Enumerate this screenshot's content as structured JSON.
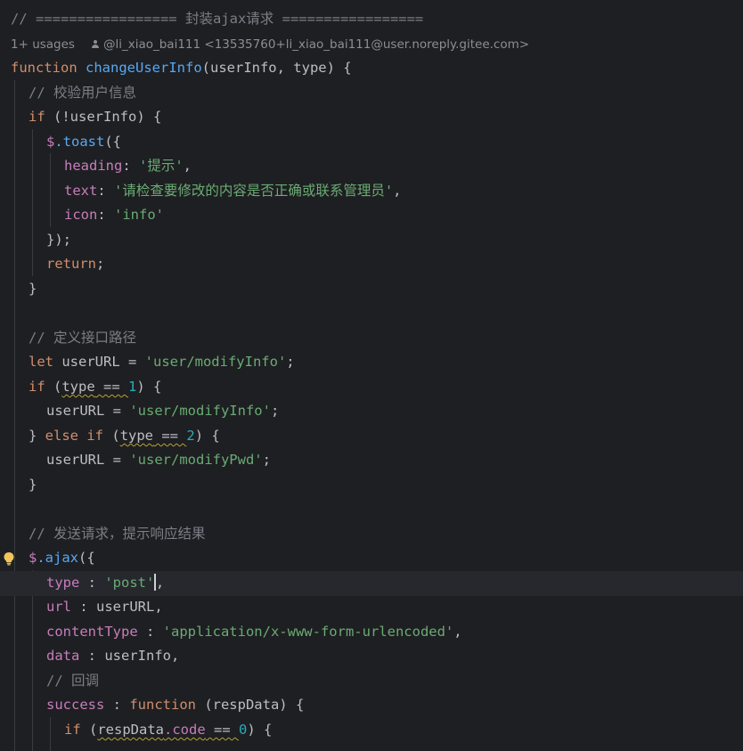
{
  "header_comment": {
    "prefix": "// ================= ",
    "title": "封装ajax请求",
    "suffix": " ================="
  },
  "inlay": {
    "usages": "1+ usages",
    "author": "@li_xiao_bai111 <13535760+li_xiao_bai111@user.noreply.gitee.com>"
  },
  "code": {
    "kw_function": "function",
    "fn_name": "changeUserInfo",
    "signature": "(userInfo, type) {",
    "comment_validate": "// 校验用户信息",
    "kw_if": "if",
    "if_not_userinfo": " (!userInfo) {",
    "dollar": "$",
    "toast": ".toast",
    "toast_open": "({",
    "heading_key": "heading",
    "heading_value": "'提示'",
    "text_key": "text",
    "text_value": "'请检查要修改的内容是否正确或联系管理员'",
    "icon_key": "icon",
    "icon_value": "'info'",
    "toast_close": "});",
    "kw_return": "return",
    "semicolon": ";",
    "close_brace": "}",
    "comment_define_url": "// 定义接口路径",
    "kw_let": "let",
    "let_userurl": " userURL = ",
    "url_modify_info": "'user/modifyInfo'",
    "open_paren": " (",
    "type_var": "type",
    "eq": " == ",
    "num_1": "1",
    "close_paren_brace": ") {",
    "userurl_assign": "userURL = ",
    "else_prefix": "} ",
    "kw_else": "else",
    "num_2": "2",
    "url_modify_pwd": "'user/modifyPwd'",
    "comment_send": "// 发送请求，提示响应结果",
    "ajax": ".ajax",
    "ajax_open": "({",
    "type_key": "type",
    "colon_spaced": " : ",
    "post_value": "'post'",
    "comma": ",",
    "url_key": "url",
    "url_value": "userURL,",
    "content_type_key": "contentType",
    "content_type_value": "'application/x-www-form-urlencoded'",
    "data_key": "data",
    "data_value": "userInfo,",
    "comment_callback": "// 回调",
    "success_key": "success",
    "success_params": " (respData) {",
    "resp_data": "respData",
    "dot_code": ".code",
    "num_0": "0",
    "space": " "
  },
  "colors": {
    "background": "#1e1f22",
    "current_line": "#26282e",
    "keyword": "#cf8e6d",
    "function": "#56a8f5",
    "string": "#6aab73",
    "property": "#c77dbb",
    "number": "#2aacb8",
    "comment": "#7a7e85",
    "text": "#bcbec4"
  },
  "icons": [
    "intention-bulb-icon",
    "author-icon"
  ]
}
